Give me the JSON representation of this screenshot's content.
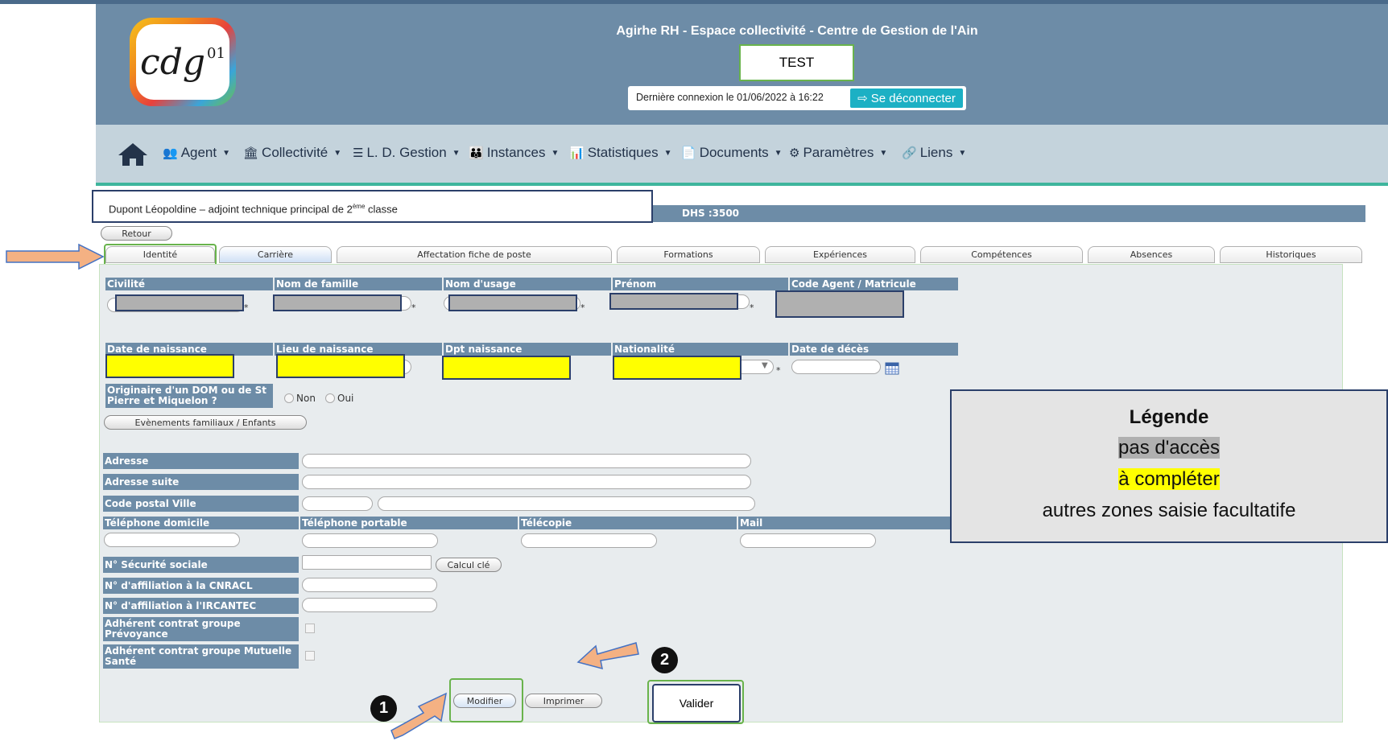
{
  "header": {
    "logo_text": "cdg",
    "logo_sup": "01",
    "app_title": "Agirhe RH - Espace collectivité - Centre de Gestion de l'Ain",
    "env_badge": "TEST",
    "last_login": "Dernière connexion le 01/06/2022 à 16:22",
    "logout_label": "Se déconnecter"
  },
  "nav": {
    "items": [
      {
        "label": "Agent",
        "icon": "users-icon"
      },
      {
        "label": "Collectivité",
        "icon": "bank-icon"
      },
      {
        "label": "L. D. Gestion",
        "icon": "list-icon"
      },
      {
        "label": "Instances",
        "icon": "meeting-icon"
      },
      {
        "label": "Statistiques",
        "icon": "chart-icon"
      },
      {
        "label": "Documents",
        "icon": "document-icon"
      },
      {
        "label": "Paramètres",
        "icon": "gears-icon"
      },
      {
        "label": "Liens",
        "icon": "link-icon"
      }
    ]
  },
  "agent": {
    "name_line": "Dupont Léopoldine – adjoint technique principal de 2",
    "name_sup": "ème",
    "name_suffix": " classe",
    "dhs": "DHS :3500"
  },
  "back_label": "Retour",
  "tabs": [
    "Identité",
    "Carrière",
    "Affectation fiche de poste",
    "Formations",
    "Expériences",
    "Compétences",
    "Absences",
    "Historiques"
  ],
  "form": {
    "civilite": "Civilité",
    "nom_famille": "Nom de famille",
    "nom_usage": "Nom d'usage",
    "prenom": "Prénom",
    "code_agent": "Code Agent / Matricule",
    "date_naissance": "Date de naissance",
    "lieu_naissance": "Lieu de naissance",
    "dpt_naissance": "Dpt naissance",
    "nationalite": "Nationalité",
    "date_deces": "Date de décès",
    "dom_question": "Originaire d'un DOM ou de St Pierre et Miquelon ?",
    "radio_non": "Non",
    "radio_oui": "Oui",
    "events_button": "Evènements familiaux / Enfants",
    "adresse": "Adresse",
    "adresse_suite": "Adresse suite",
    "cp_ville": "Code postal Ville",
    "tel_domicile": "Téléphone domicile",
    "tel_portable": "Téléphone portable",
    "telecopie": "Télécopie",
    "mail": "Mail",
    "secu": "N° Sécurité sociale",
    "calcul_cle": "Calcul clé",
    "cnracl": "N° d'affiliation à la CNRACL",
    "ircantec": "N° d'affiliation à l'IRCANTEC",
    "prevoyance": "Adhérent contrat groupe Prévoyance",
    "mutuelle": "Adhérent contrat groupe Mutuelle Santé",
    "required_mark": "*"
  },
  "actions": {
    "modifier": "Modifier",
    "imprimer": "Imprimer",
    "valider": "Valider"
  },
  "annotations": {
    "step1": "1",
    "step2": "2"
  },
  "legend": {
    "title": "Légende",
    "no_access": "pas d'accès",
    "to_complete": "à compléter",
    "optional": "autres zones saisie facultatife"
  },
  "colors": {
    "header_bg": "#6d8ca7",
    "nav_bg": "#c4d3dc",
    "accent_green": "#69b34c",
    "arrow_orange": "#f4b183",
    "highlight_yellow": "#ffff00",
    "highlight_grey": "#b0b0b0"
  }
}
